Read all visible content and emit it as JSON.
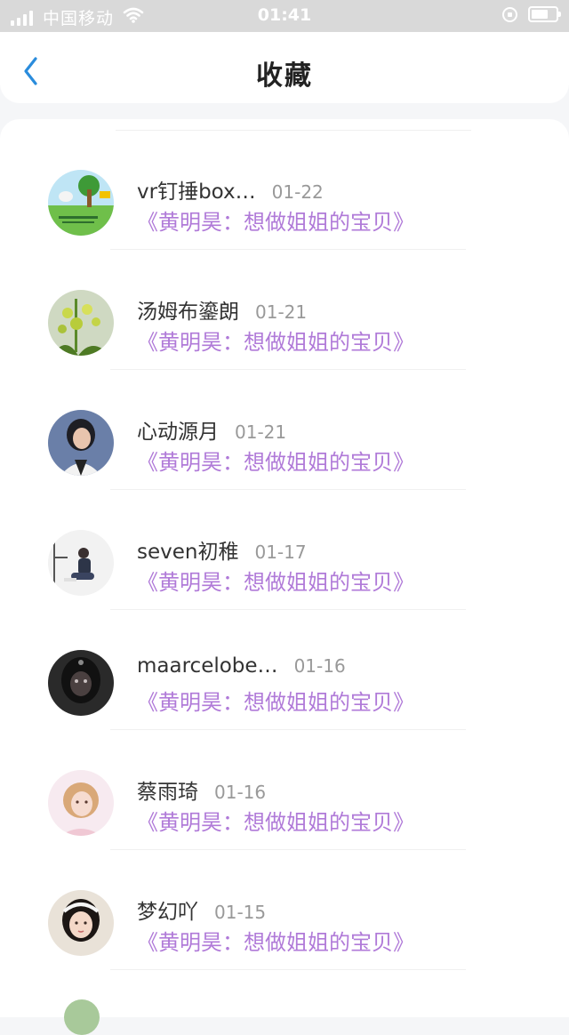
{
  "status_bar": {
    "carrier": "中国移动",
    "time": "01:41"
  },
  "nav": {
    "title": "收藏",
    "back_icon": "chevron-left-icon",
    "accent_color": "#2a8cdc"
  },
  "favorites": [
    {
      "name": "vr钉捶box…",
      "date": "01-22",
      "subtitle": "《黄明昊：想做姐姐的宝贝》",
      "avatar": "cartoon-landscape"
    },
    {
      "name": "汤姆布鎏朗",
      "date": "01-21",
      "subtitle": "《黄明昊：想做姐姐的宝贝》",
      "avatar": "green-plant"
    },
    {
      "name": "心动源月",
      "date": "01-21",
      "subtitle": "《黄明昊：想做姐姐的宝贝》",
      "avatar": "girl-portrait"
    },
    {
      "name": "seven初稚",
      "date": "01-17",
      "subtitle": "《黄明昊：想做姐姐的宝贝》",
      "avatar": "girl-sitting"
    },
    {
      "name": "maarcelobe…",
      "date": "01-16",
      "subtitle": "《黄明昊：想做姐姐的宝贝》",
      "avatar": "dark-hood"
    },
    {
      "name": "蔡雨琦",
      "date": "01-16",
      "subtitle": "《黄明昊：想做姐姐的宝贝》",
      "avatar": "girl-pink"
    },
    {
      "name": "梦幻吖",
      "date": "01-15",
      "subtitle": "《黄明昊：想做姐姐的宝贝》",
      "avatar": "girl-headband"
    }
  ],
  "colors": {
    "subtitle": "#b07ad8",
    "date": "#999999",
    "name": "#333333"
  }
}
